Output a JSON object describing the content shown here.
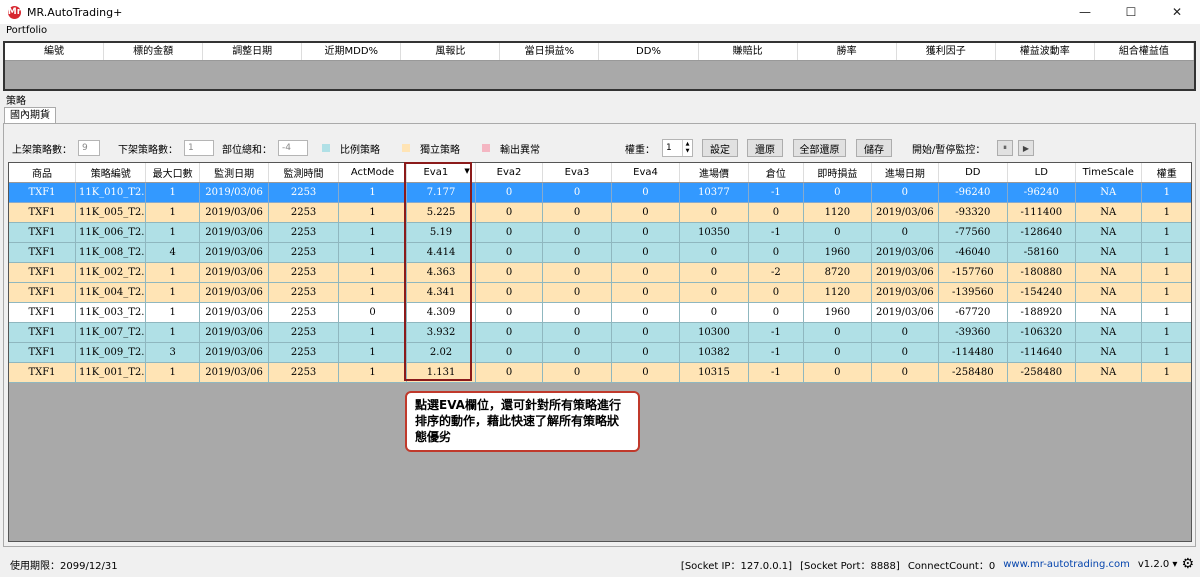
{
  "app": {
    "title": "MR.AutoTrading+",
    "logo_text": "Mr"
  },
  "window_controls": {
    "minimize": "—",
    "maximize": "☐",
    "close": "✕"
  },
  "portfolio": {
    "label": "Portfolio",
    "columns": [
      "編號",
      "標的金額",
      "調整日期",
      "近期MDD%",
      "風報比",
      "當日損益%",
      "DD%",
      "賺賠比",
      "勝率",
      "獲利因子",
      "權益波動率",
      "組合權益值"
    ]
  },
  "strategy": {
    "label": "策略",
    "tab": "國內期貨",
    "controls": {
      "listed_label": "上架策略數：",
      "listed_value": "9",
      "unlisted_label": "下架策略數：",
      "unlisted_value": "1",
      "position_label": "部位總和：",
      "position_value": "-4",
      "legend": [
        {
          "label": "比例策略",
          "color": "#b0e0e6"
        },
        {
          "label": "獨立策略",
          "color": "#ffe4b5"
        },
        {
          "label": "輸出異常",
          "color": "#f4b6c2"
        }
      ],
      "weight_label": "權重：",
      "weight_value": "1",
      "set_button": "設定",
      "restore_button": "還原",
      "restore_all_button": "全部還原",
      "save_button": "儲存",
      "monitor_label": "開始/暫停監控：",
      "pause_icon": "⏸",
      "play_icon": "▶"
    },
    "columns": [
      "商品",
      "策略編號",
      "最大口數",
      "監測日期",
      "監測時間",
      "ActMode",
      "Eva1",
      "Eva2",
      "Eva3",
      "Eva4",
      "進場價",
      "倉位",
      "即時損益",
      "進場日期",
      "DD",
      "LD",
      "TimeScale",
      "權重"
    ],
    "sort_indicator": "▼",
    "rows": [
      {
        "style": "selected",
        "cells": [
          "TXF1",
          "11K_010_T2...",
          "1",
          "2019/03/06",
          "2253",
          "1",
          "7.177",
          "0",
          "0",
          "0",
          "10377",
          "-1",
          "0",
          "0",
          "-96240",
          "-96240",
          "NA",
          "1"
        ]
      },
      {
        "style": "orange",
        "cells": [
          "TXF1",
          "11K_005_T2...",
          "1",
          "2019/03/06",
          "2253",
          "1",
          "5.225",
          "0",
          "0",
          "0",
          "0",
          "0",
          "1120",
          "2019/03/06",
          "-93320",
          "-111400",
          "NA",
          "1"
        ]
      },
      {
        "style": "blue",
        "cells": [
          "TXF1",
          "11K_006_T2...",
          "1",
          "2019/03/06",
          "2253",
          "1",
          "5.19",
          "0",
          "0",
          "0",
          "10350",
          "-1",
          "0",
          "0",
          "-77560",
          "-128640",
          "NA",
          "1"
        ]
      },
      {
        "style": "blue",
        "cells": [
          "TXF1",
          "11K_008_T2...",
          "4",
          "2019/03/06",
          "2253",
          "1",
          "4.414",
          "0",
          "0",
          "0",
          "0",
          "0",
          "1960",
          "2019/03/06",
          "-46040",
          "-58160",
          "NA",
          "1"
        ]
      },
      {
        "style": "orange",
        "cells": [
          "TXF1",
          "11K_002_T2...",
          "1",
          "2019/03/06",
          "2253",
          "1",
          "4.363",
          "0",
          "0",
          "0",
          "0",
          "-2",
          "8720",
          "2019/03/06",
          "-157760",
          "-180880",
          "NA",
          "1"
        ]
      },
      {
        "style": "orange",
        "cells": [
          "TXF1",
          "11K_004_T2...",
          "1",
          "2019/03/06",
          "2253",
          "1",
          "4.341",
          "0",
          "0",
          "0",
          "0",
          "0",
          "1120",
          "2019/03/06",
          "-139560",
          "-154240",
          "NA",
          "1"
        ]
      },
      {
        "style": "white",
        "cells": [
          "TXF1",
          "11K_003_T2...",
          "1",
          "2019/03/06",
          "2253",
          "0",
          "4.309",
          "0",
          "0",
          "0",
          "0",
          "0",
          "1960",
          "2019/03/06",
          "-67720",
          "-188920",
          "NA",
          "1"
        ]
      },
      {
        "style": "blue",
        "cells": [
          "TXF1",
          "11K_007_T2...",
          "1",
          "2019/03/06",
          "2253",
          "1",
          "3.932",
          "0",
          "0",
          "0",
          "10300",
          "-1",
          "0",
          "0",
          "-39360",
          "-106320",
          "NA",
          "1"
        ]
      },
      {
        "style": "blue",
        "cells": [
          "TXF1",
          "11K_009_T2...",
          "3",
          "2019/03/06",
          "2253",
          "1",
          "2.02",
          "0",
          "0",
          "0",
          "10382",
          "-1",
          "0",
          "0",
          "-114480",
          "-114640",
          "NA",
          "1"
        ]
      },
      {
        "style": "orange",
        "cells": [
          "TXF1",
          "11K_001_T2...",
          "1",
          "2019/03/06",
          "2253",
          "1",
          "1.131",
          "0",
          "0",
          "0",
          "10315",
          "-1",
          "0",
          "0",
          "-258480",
          "-258480",
          "NA",
          "1"
        ]
      }
    ]
  },
  "callout": {
    "text": "點選EVA欄位，還可針對所有策略進行排序的動作，藉此快速了解所有策略狀態優劣"
  },
  "status": {
    "expiry": "使用期限：2099/12/31",
    "socket_ip": "[Socket IP：127.0.0.1]",
    "socket_port": "[Socket Port：8888]",
    "connect_count": "ConnectCount：0",
    "website": "www.mr-autotrading.com",
    "version": "v1.2.0 ▾",
    "gear_icon": "⚙"
  }
}
